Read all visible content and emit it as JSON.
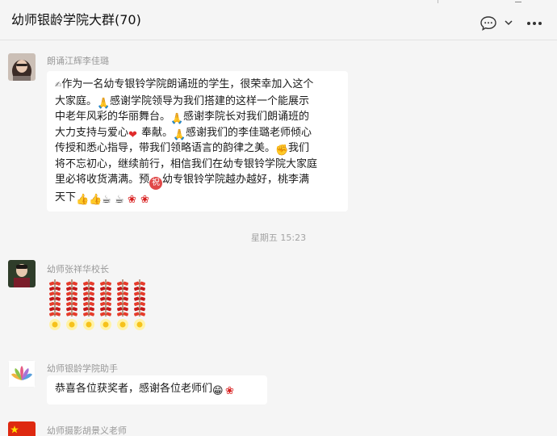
{
  "chat": {
    "title": "幼师银龄学院大群(70)"
  },
  "messages": [
    {
      "sender": "朗诵江辉李佳璐",
      "text_lines": [
        "作为一名幼专银铃学院朗诵班的学生，很荣幸加入这个",
        "大家庭。",
        "感谢学院领导为我们搭建的这样一个能展示",
        "中老年风彩的华丽舞台。",
        "感谢李院长对我们朗诵班的",
        "大力支持与爱心",
        "奉献。",
        "感谢我们的李佳璐老师倾心",
        "传授和悉心指导，带我们领略语言的韵律之美。",
        "我们",
        "将不忘初心，继续前行，相信我们在幼专银铃学院大家庭",
        "里必将收货满满。预",
        "幼专银铃学院越办越好，桃李满",
        "天下"
      ]
    },
    {
      "timestamp": "星期五 15:23"
    },
    {
      "sender": "幼师张祥华校长",
      "sticker": "firecracker-sticker"
    },
    {
      "sender": "幼师银龄学院助手",
      "text": "恭喜各位获奖者，感谢各位老师们"
    },
    {
      "sender": "幼师摄影胡景义老师"
    }
  ],
  "icons": {
    "chat-bubble": "chat-bubble-icon",
    "chevron": "chevron-down-icon",
    "more": "more-icon"
  },
  "colors": {
    "background": "#f5f5f5",
    "bubble": "#ffffff",
    "sender_text": "#999999",
    "heart": "#e02b2b",
    "rose": "#d81e1e"
  }
}
